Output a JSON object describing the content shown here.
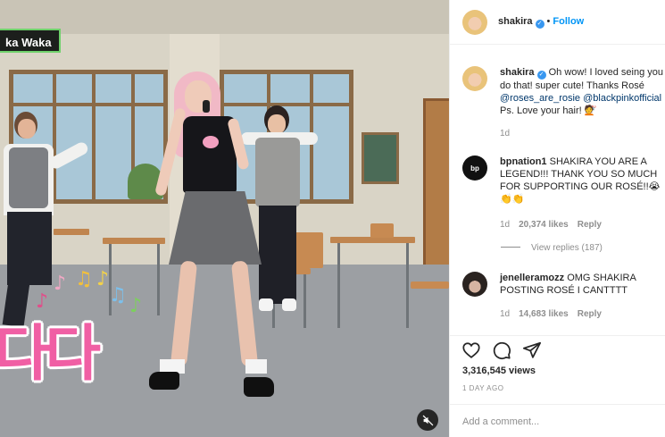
{
  "video": {
    "show_badge": "ka Waka",
    "caption_korean": "다다",
    "mute_icon": "speaker-muted-icon"
  },
  "post_header": {
    "username": "shakira",
    "separator": "•",
    "follow_label": "Follow",
    "verified": true
  },
  "caption": {
    "username": "shakira",
    "text_before": "Oh wow! I loved seing you do that! super cute! Thanks Rosé",
    "mention1": "@roses_are_rosie",
    "mention2": "@blackpinkofficial",
    "text_after": "Ps. Love your hair! 💇",
    "age": "1d"
  },
  "comments": [
    {
      "username": "bpnation1",
      "avatar_text": "bp",
      "text": "SHAKIRA YOU ARE A LEGEND!!! THANK YOU SO MUCH FOR SUPPORTING OUR ROSÉ!!😭👏👏",
      "age": "1d",
      "likes": "20,374 likes",
      "reply": "Reply",
      "view_replies": "View replies (187)"
    },
    {
      "username": "jenelleramozz",
      "text": "OMG SHAKIRA POSTING ROSÉ I CANTTTT",
      "age": "1d",
      "likes": "14,683 likes",
      "reply": "Reply"
    }
  ],
  "actions": {
    "views": "3,316,545 views",
    "date": "1 DAY AGO",
    "icons": [
      "heart-icon",
      "comment-icon",
      "share-icon"
    ]
  },
  "add_comment": {
    "placeholder": "Add a comment..."
  },
  "colors": {
    "link_blue": "#0095f6",
    "mention_blue": "#00376b",
    "muted_gray": "#8e8e8e",
    "caption_pink": "#f05fa4"
  }
}
